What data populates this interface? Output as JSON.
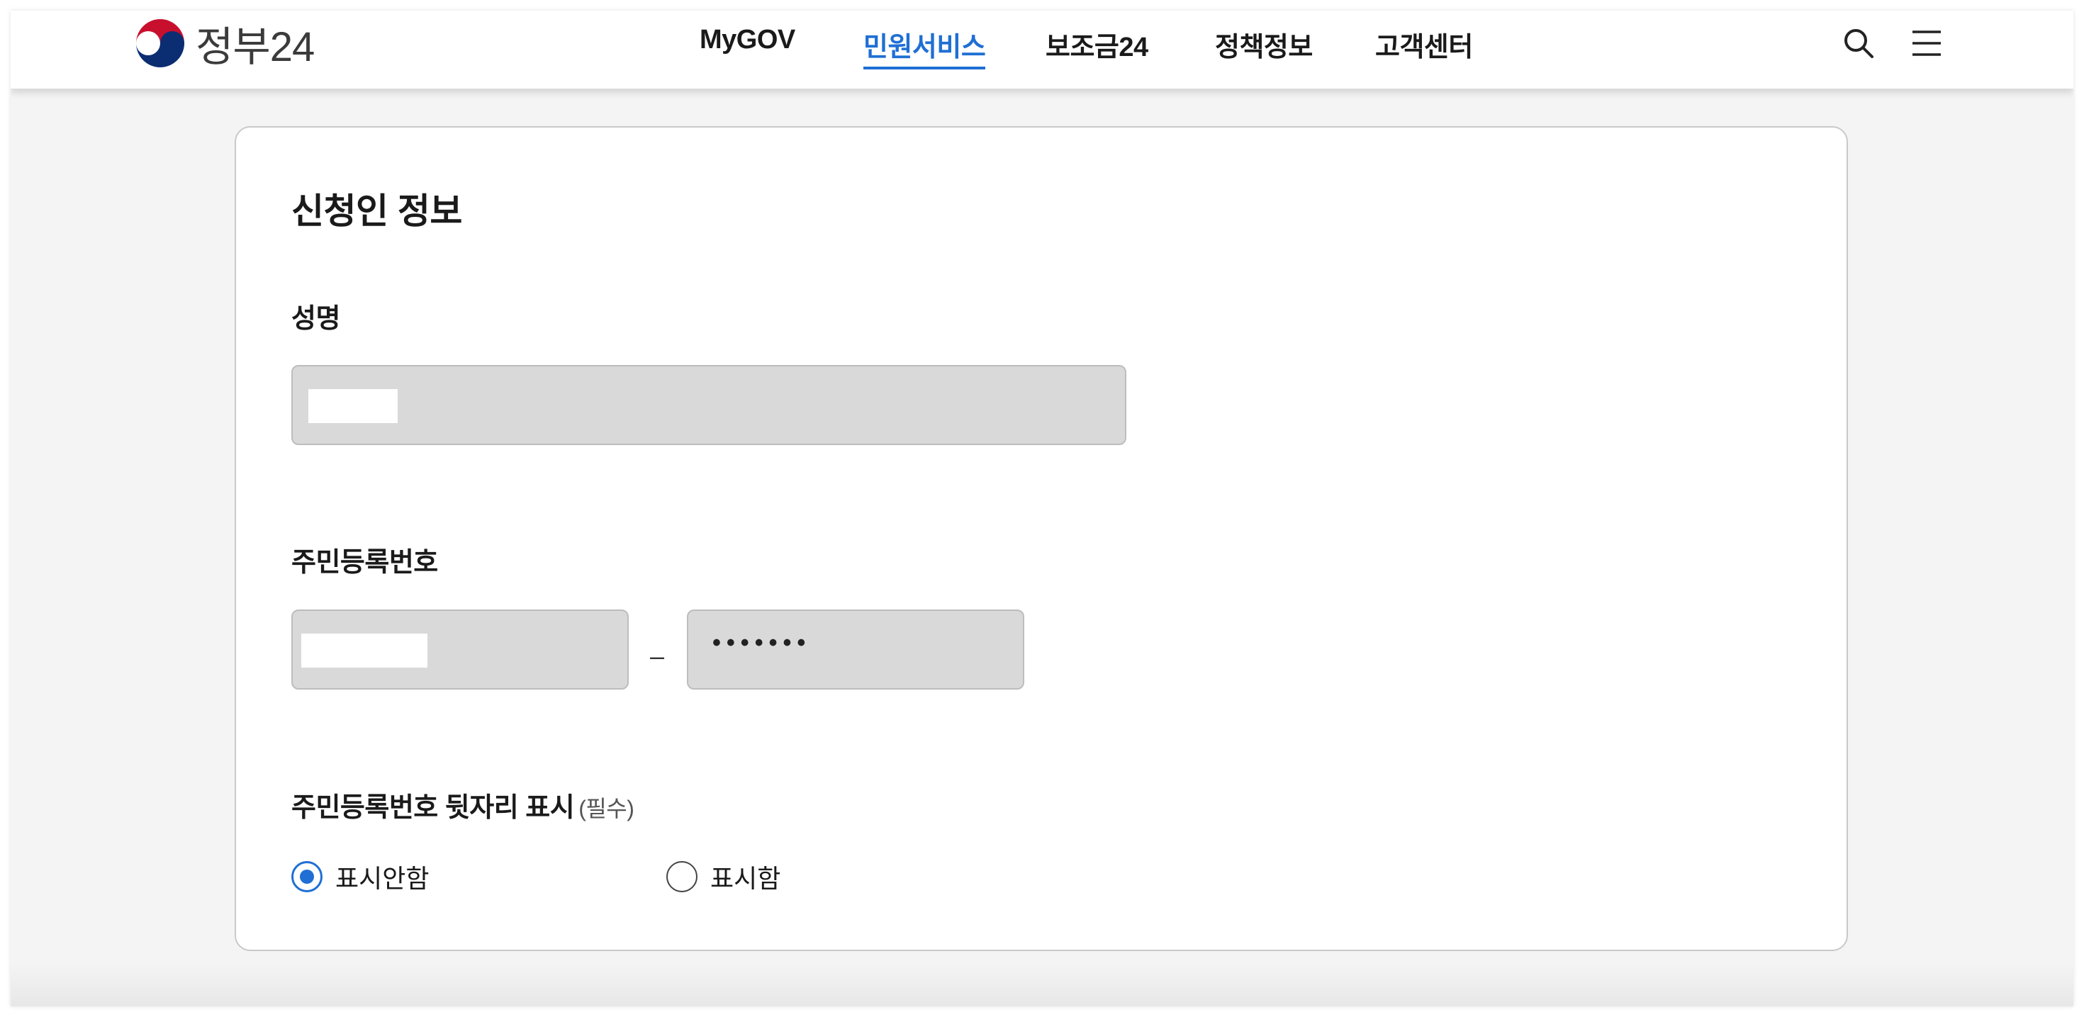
{
  "header": {
    "logo_text": "정부24",
    "nav": [
      {
        "label": "MyGOV",
        "active": false
      },
      {
        "label": "민원서비스",
        "active": true
      },
      {
        "label": "보조금24",
        "active": false
      },
      {
        "label": "정책정보",
        "active": false
      },
      {
        "label": "고객센터",
        "active": false
      }
    ],
    "icons": [
      "search-icon",
      "menu-icon"
    ]
  },
  "applicant": {
    "section_title": "신청인 정보",
    "name": {
      "label": "성명",
      "value_redacted": true
    },
    "rrn": {
      "label": "주민등록번호",
      "front_value_redacted": true,
      "separator": "–",
      "back_value_masked": "•••••••"
    },
    "rrn_display": {
      "label": "주민등록번호 뒷자리 표시",
      "note": "(필수)",
      "options": [
        {
          "label": "표시안함",
          "selected": true
        },
        {
          "label": "표시함",
          "selected": false
        }
      ]
    }
  },
  "colors": {
    "accent": "#1f6fd4",
    "input_bg": "#d9d9d9",
    "page_bg": "#f4f4f4",
    "text": "#1a1a1a"
  }
}
